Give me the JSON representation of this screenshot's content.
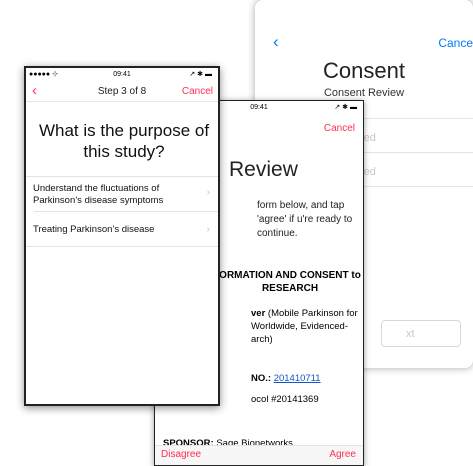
{
  "consent_screen": {
    "back_icon": "chevron-left-icon",
    "cancel_label": "Cance",
    "title": "Consent",
    "subtitle": "Consent Review",
    "row1_text": "red",
    "row2_text": "red",
    "button_label": "xt",
    "accent": "#007aff"
  },
  "review_screen": {
    "status_time": "09:41",
    "status_right": "↗ ✱ ▬",
    "cancel_label": "Cancel",
    "title": "Review",
    "instructions": "form below, and tap 'agree' if u're ready to continue.",
    "header": "ORMATION AND CONSENT to RESEARCH",
    "paragraph1_bold": "ver",
    "paragraph1_rest": " (Mobile Parkinson for Worldwide, Evidenced-arch)",
    "protocol_label": "NO.: ",
    "protocol_link": "201410711",
    "protocol_line": "ocol #20141369",
    "sponsor_bold": "SPONSOR:",
    "sponsor_value": " Sage Bionetworks",
    "disagree_label": "Disagree",
    "agree_label": "Agree",
    "accent": "#ff2d55"
  },
  "question_screen": {
    "status_left": "●●●●● ⊹",
    "status_time": "09:41",
    "status_right": "↗ ✱ ▬",
    "back_icon": "chevron-left-icon",
    "step_label": "Step 3 of 8",
    "cancel_label": "Cancel",
    "question": "What is the purpose of this study?",
    "options": [
      {
        "label": "Understand the fluctuations of Parkinson’s disease symptoms"
      },
      {
        "label": "Treating Parkinson’s disease"
      }
    ],
    "chevron": "›",
    "accent": "#ff2d55"
  }
}
